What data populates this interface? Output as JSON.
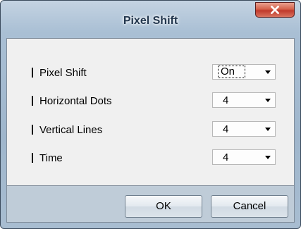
{
  "window": {
    "title": "Pixel Shift",
    "close_icon": "close-icon"
  },
  "settings": [
    {
      "label": "Pixel Shift",
      "value": "On"
    },
    {
      "label": "Horizontal Dots",
      "value": "4"
    },
    {
      "label": "Vertical Lines",
      "value": "4"
    },
    {
      "label": "Time",
      "value": "4"
    }
  ],
  "buttons": {
    "ok_label": "OK",
    "cancel_label": "Cancel"
  },
  "colors": {
    "close_button": "#c0392b",
    "content_background": "#f0f0f0",
    "frame": "#9fb6cc"
  }
}
